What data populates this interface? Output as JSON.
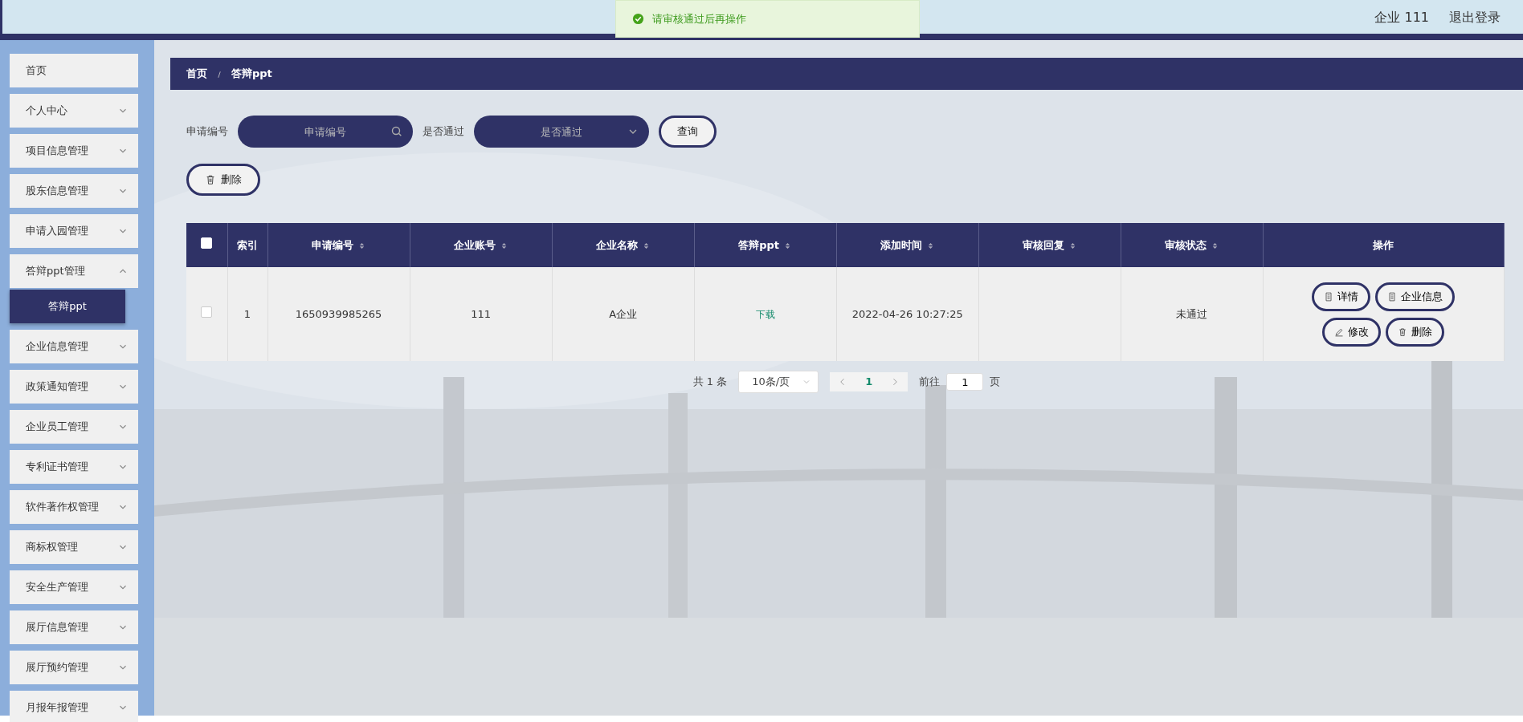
{
  "toast": {
    "text": "请审核通过后再操作"
  },
  "header": {
    "user": "企业 111",
    "logout": "退出登录"
  },
  "sidebar": {
    "items": [
      {
        "label": "首页",
        "expandable": false
      },
      {
        "label": "个人中心",
        "expandable": true,
        "expanded": false
      },
      {
        "label": "项目信息管理",
        "expandable": true,
        "expanded": false
      },
      {
        "label": "股东信息管理",
        "expandable": true,
        "expanded": false
      },
      {
        "label": "申请入园管理",
        "expandable": true,
        "expanded": false
      },
      {
        "label": "答辩ppt管理",
        "expandable": true,
        "expanded": true,
        "children": [
          {
            "label": "答辩ppt",
            "selected": true
          }
        ]
      },
      {
        "label": "企业信息管理",
        "expandable": true,
        "expanded": false
      },
      {
        "label": "政策通知管理",
        "expandable": true,
        "expanded": false
      },
      {
        "label": "企业员工管理",
        "expandable": true,
        "expanded": false
      },
      {
        "label": "专利证书管理",
        "expandable": true,
        "expanded": false
      },
      {
        "label": "软件著作权管理",
        "expandable": true,
        "expanded": false
      },
      {
        "label": "商标权管理",
        "expandable": true,
        "expanded": false
      },
      {
        "label": "安全生产管理",
        "expandable": true,
        "expanded": false
      },
      {
        "label": "展厅信息管理",
        "expandable": true,
        "expanded": false
      },
      {
        "label": "展厅预约管理",
        "expandable": true,
        "expanded": false
      },
      {
        "label": "月报年报管理",
        "expandable": true,
        "expanded": false
      }
    ]
  },
  "breadcrumb": [
    "首页",
    "答辩ppt"
  ],
  "search": {
    "fields": [
      {
        "label": "申请编号",
        "placeholder": "申请编号",
        "kind": "input"
      },
      {
        "label": "是否通过",
        "placeholder": "是否通过",
        "kind": "select"
      }
    ],
    "button": "查询"
  },
  "actions": {
    "delete": "删除"
  },
  "table": {
    "select_all": false,
    "columns": [
      {
        "label": "索引",
        "sortable": false
      },
      {
        "label": "申请编号",
        "sortable": true
      },
      {
        "label": "企业账号",
        "sortable": true
      },
      {
        "label": "企业名称",
        "sortable": true
      },
      {
        "label": "答辩ppt",
        "sortable": true
      },
      {
        "label": "添加时间",
        "sortable": true
      },
      {
        "label": "审核回复",
        "sortable": true
      },
      {
        "label": "审核状态",
        "sortable": true
      },
      {
        "label": "操作",
        "sortable": false
      }
    ],
    "rows": [
      {
        "checked": false,
        "index": "1",
        "application_no": "1650939985265",
        "account": "111",
        "company": "A企业",
        "ppt": "下载",
        "added": "2022-04-26 10:27:25",
        "status": "未通过",
        "buttons": [
          {
            "label": "详情",
            "kind": "doc"
          },
          {
            "label": "企业信息",
            "kind": "doc"
          },
          {
            "label": "修改",
            "kind": "edit"
          },
          {
            "label": "删除",
            "kind": "trash"
          }
        ]
      }
    ]
  },
  "pagination": {
    "total": "共 1 条",
    "page_size": "10条/页",
    "pages": [
      {
        "label": "1",
        "selected": true
      }
    ],
    "goto_label": "前往",
    "goto_value": "1",
    "goto_suffix": "页"
  }
}
